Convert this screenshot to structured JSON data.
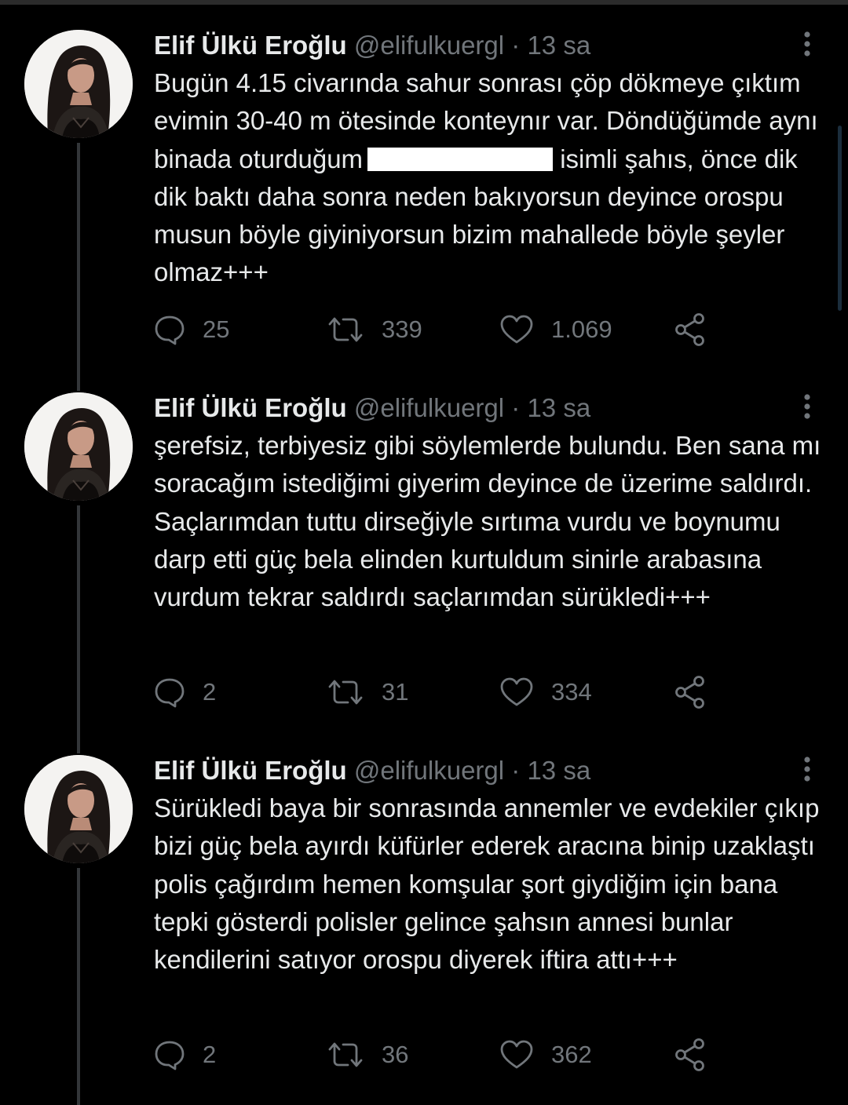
{
  "colors": {
    "background": "#000000",
    "primary_text": "#e7e9ea",
    "secondary_text": "#71767b",
    "thread_line": "#333639",
    "redaction": "#ffffff"
  },
  "icons": {
    "reply": "speech-bubble-icon",
    "retweet": "retweet-arrows-icon",
    "like": "heart-icon",
    "share": "share-nodes-icon",
    "more": "vertical-dots-icon"
  },
  "tweets": [
    {
      "name": "Elif Ülkü Eroğlu",
      "handle": "@elifulkuergl",
      "separator": "·",
      "time": "13 sa",
      "text_part1": "Bugün 4.15 civarında sahur sonrası çöp dökmeye çıktım evimin 30-40 m ötesinde konteynır var. Döndüğümde aynı binada oturduğum",
      "text_part2": "isimli şahıs, önce dik dik baktı  daha sonra neden bakıyorsun deyince orospu musun böyle giyiniyorsun bizim mahallede böyle şeyler olmaz+++",
      "replies": "25",
      "retweets": "339",
      "likes": "1.069"
    },
    {
      "name": "Elif Ülkü Eroğlu",
      "handle": "@elifulkuergl",
      "separator": "·",
      "time": "13 sa",
      "text": "şerefsiz, terbiyesiz gibi söylemlerde bulundu. Ben sana mı soracağım istediğimi giyerim deyince de üzerime saldırdı. Saçlarımdan tuttu dirseğiyle sırtıma vurdu ve boynumu darp etti güç bela elinden kurtuldum sinirle arabasına vurdum tekrar saldırdı saçlarımdan sürükledi+++",
      "replies": "2",
      "retweets": "31",
      "likes": "334"
    },
    {
      "name": "Elif Ülkü Eroğlu",
      "handle": "@elifulkuergl",
      "separator": "·",
      "time": "13 sa",
      "text": "Sürükledi baya bir sonrasında annemler ve evdekiler çıkıp bizi güç bela ayırdı küfürler ederek aracına binip uzaklaştı polis çağırdım hemen komşular şort giydiğim için bana tepki gösterdi polisler gelince şahsın annesi bunlar kendilerini satıyor orospu diyerek iftira attı+++",
      "replies": "2",
      "retweets": "36",
      "likes": "362"
    }
  ]
}
